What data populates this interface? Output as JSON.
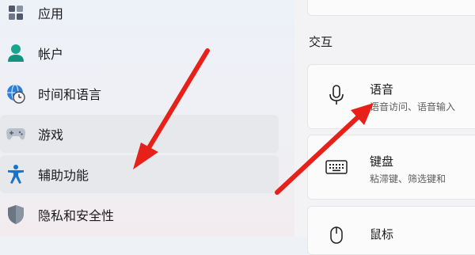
{
  "sidebar": {
    "items": [
      {
        "label": "应用",
        "icon": "apps-icon"
      },
      {
        "label": "帐户",
        "icon": "account-icon"
      },
      {
        "label": "时间和语言",
        "icon": "time-language-icon"
      },
      {
        "label": "游戏",
        "icon": "gaming-icon"
      },
      {
        "label": "辅助功能",
        "icon": "accessibility-icon"
      },
      {
        "label": "隐私和安全性",
        "icon": "privacy-shield-icon"
      }
    ]
  },
  "main": {
    "section_title": "交互",
    "settings": [
      {
        "title": "语音",
        "desc": "语音访问、语音输入",
        "icon": "microphone-icon"
      },
      {
        "title": "键盘",
        "desc": "粘滞键、筛选键和",
        "icon": "keyboard-icon"
      },
      {
        "title": "鼠标",
        "desc": "",
        "icon": "mouse-icon"
      }
    ]
  },
  "colors": {
    "arrow": "#e8201a",
    "accent_blue": "#0f6cbd",
    "teal": "#1a9c8a"
  }
}
